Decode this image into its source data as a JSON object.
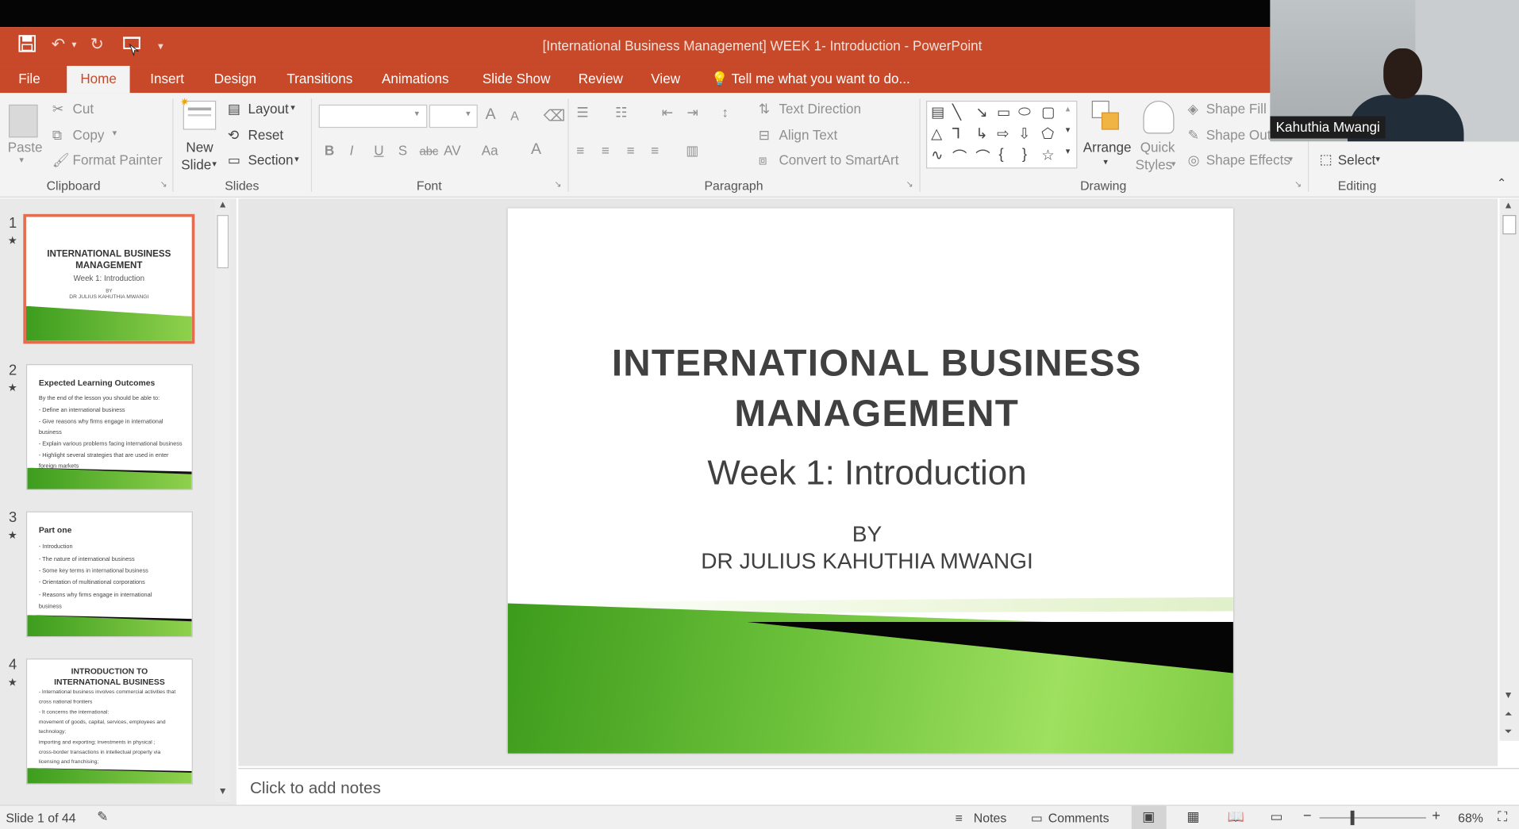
{
  "window": {
    "title": "[International Business Management] WEEK 1- Introduction - PowerPoint"
  },
  "qat": {
    "save": "save-icon",
    "undo": "undo-icon",
    "redo": "redo-icon",
    "start": "start-from-beginning-icon",
    "more": "▾"
  },
  "tabs": [
    "File",
    "Home",
    "Insert",
    "Design",
    "Transitions",
    "Animations",
    "Slide Show",
    "Review",
    "View"
  ],
  "tell_me": "Tell me what you want to do...",
  "ribbon": {
    "clipboard": {
      "paste": "Paste",
      "cut": "Cut",
      "copy": "Copy",
      "format_painter": "Format Painter",
      "label": "Clipboard"
    },
    "slides": {
      "new_slide_1": "New",
      "new_slide_2": "Slide",
      "layout": "Layout",
      "reset": "Reset",
      "section": "Section",
      "label": "Slides"
    },
    "font": {
      "label": "Font",
      "bold": "B",
      "italic": "I",
      "underline": "U",
      "shadow": "S",
      "strike": "abc",
      "spacing": "AV",
      "case": "Aa",
      "color": "A",
      "grow": "A",
      "shrink": "A"
    },
    "paragraph": {
      "text_direction": "Text Direction",
      "align_text": "Align Text",
      "smartart": "Convert to SmartArt",
      "label": "Paragraph"
    },
    "drawing": {
      "arrange": "Arrange",
      "quick_1": "Quick",
      "quick_2": "Styles",
      "shape_fill": "Shape Fill",
      "shape_outline": "Shape Out",
      "shape_effects": "Shape Effects",
      "label": "Drawing"
    },
    "editing": {
      "select": "Select",
      "label": "Editing"
    }
  },
  "video": {
    "name": "Kahuthia Mwangi"
  },
  "thumbnails": [
    {
      "num": "1",
      "title1": "INTERNATIONAL BUSINESS",
      "title2": "MANAGEMENT",
      "sub": "Week 1: Introduction",
      "by": "BY",
      "author": "DR JULIUS KAHUTHIA MWANGI"
    },
    {
      "num": "2",
      "title": "Expected Learning Outcomes",
      "lines": [
        "By the end of the lesson you should be able to:",
        "- Define an international business",
        "- Give reasons why firms engage in international",
        "  business",
        "- Explain various problems facing international business",
        "- Highlight several strategies that are used in enter",
        "  foreign markets"
      ]
    },
    {
      "num": "3",
      "title": "Part one",
      "lines": [
        "- Introduction",
        "- The nature of international business",
        "- Some key terms in international business",
        "- Orientation of multinational corporations",
        "- Reasons why firms engage in international",
        "  business"
      ]
    },
    {
      "num": "4",
      "title1": "INTRODUCTION TO",
      "title2": "INTERNATIONAL BUSINESS",
      "lines": [
        "- International business involves commercial activities that",
        "  cross national frontiers",
        "- It concerns the international:",
        "  movement of goods, capital, services, employees and",
        "  technology;",
        "  importing and exporting; investments in physical ;",
        "  cross-border transactions in intellectual property via",
        "  licensing and franchising;"
      ]
    }
  ],
  "slide": {
    "title1": "INTERNATIONAL BUSINESS",
    "title2": "MANAGEMENT",
    "subtitle": "Week 1: Introduction",
    "by": "BY",
    "author": "DR JULIUS KAHUTHIA MWANGI"
  },
  "notes": {
    "placeholder": "Click to add notes"
  },
  "status": {
    "slide": "Slide 1 of 44",
    "notes": "Notes",
    "comments": "Comments",
    "zoom": "68%"
  },
  "colors": {
    "accent": "#c8492a",
    "selected_thumb": "#e46c4f",
    "green": "#6cc13a"
  }
}
